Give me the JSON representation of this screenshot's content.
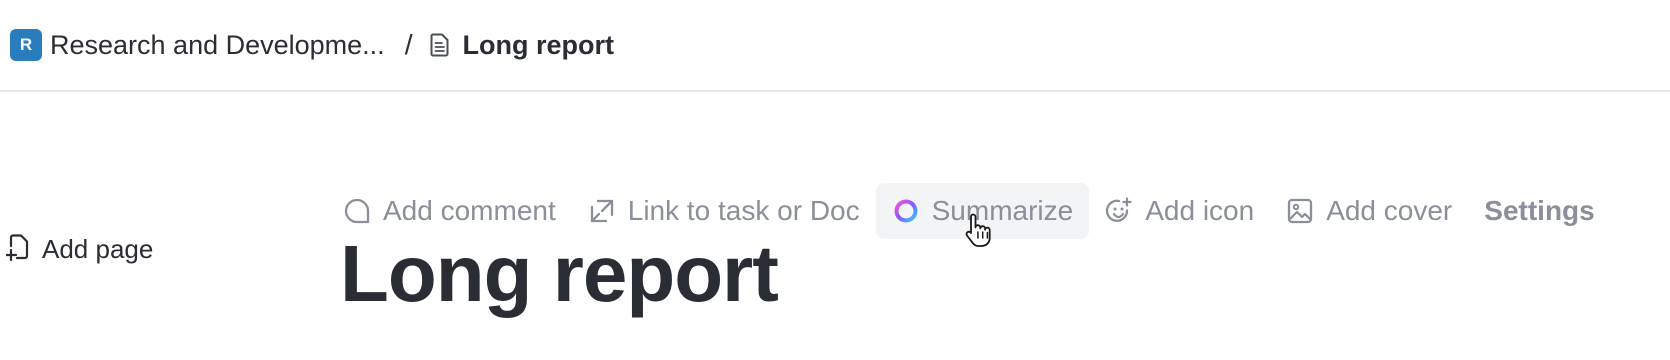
{
  "breadcrumb": {
    "space_avatar_letter": "R",
    "space_avatar_color": "#2a7dbd",
    "space_name": "Research and Developme...",
    "separator": "/",
    "doc_icon": "document-icon",
    "doc_name": "Long report"
  },
  "sidebar": {
    "add_page_icon": "add-page-icon",
    "add_page_label": "Add page"
  },
  "toolbar": {
    "items": [
      {
        "icon": "comment-icon",
        "label": "Add comment"
      },
      {
        "icon": "link-icon",
        "label": "Link to task or Doc"
      },
      {
        "icon": "ai-summarize-icon",
        "label": "Summarize"
      },
      {
        "icon": "smiley-icon",
        "label": "Add icon"
      },
      {
        "icon": "image-icon",
        "label": "Add cover"
      },
      {
        "label": "Settings"
      }
    ],
    "hovered_item": "Summarize"
  },
  "document": {
    "title": "Long report"
  },
  "colors": {
    "text_dark": "#2a2e34",
    "text_muted": "#8a8f99",
    "hover_bg": "#f3f4f5",
    "divider": "#e8e9eb"
  }
}
